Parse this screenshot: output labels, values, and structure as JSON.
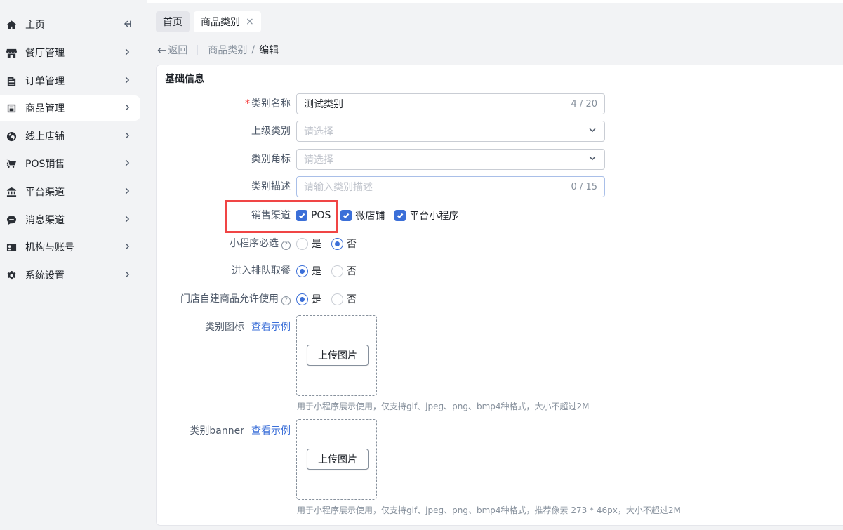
{
  "sidebar": {
    "items": [
      {
        "label": "主页",
        "icon": "home-icon"
      },
      {
        "label": "餐厅管理",
        "icon": "store-icon"
      },
      {
        "label": "订单管理",
        "icon": "order-icon"
      },
      {
        "label": "商品管理",
        "icon": "product-icon",
        "active": true
      },
      {
        "label": "线上店铺",
        "icon": "globe-icon"
      },
      {
        "label": "POS销售",
        "icon": "cart-icon"
      },
      {
        "label": "平台渠道",
        "icon": "bank-icon"
      },
      {
        "label": "消息渠道",
        "icon": "message-icon"
      },
      {
        "label": "机构与账号",
        "icon": "account-icon"
      },
      {
        "label": "系统设置",
        "icon": "gear-icon"
      }
    ]
  },
  "tabs": [
    {
      "label": "首页"
    },
    {
      "label": "商品类别",
      "close": "×"
    }
  ],
  "breadcrumb": {
    "back_arrow": "←",
    "back": "返回",
    "parent": "商品类别",
    "slash": "/",
    "current": "编辑"
  },
  "form": {
    "section_title": "基础信息",
    "name": {
      "required_mark": "*",
      "label": "类别名称",
      "value": "测试类别",
      "count": "4 / 20"
    },
    "parent": {
      "label": "上级类别",
      "placeholder": "请选择"
    },
    "corner": {
      "label": "类别角标",
      "placeholder": "请选择"
    },
    "desc": {
      "label": "类别描述",
      "placeholder": "请输入类别描述",
      "count": "0 / 15"
    },
    "channels": {
      "label": "销售渠道",
      "options": [
        {
          "label": "POS",
          "checked": true
        },
        {
          "label": "微店铺",
          "checked": true
        },
        {
          "label": "平台小程序",
          "checked": true
        }
      ]
    },
    "mini_required": {
      "label": "小程序必选",
      "help": "?",
      "yes": "是",
      "no": "否",
      "selected": "否"
    },
    "queue": {
      "label": "进入排队取餐",
      "yes": "是",
      "no": "否",
      "selected": "是"
    },
    "store_custom": {
      "label": "门店自建商品允许使用",
      "help": "?",
      "yes": "是",
      "no": "否",
      "selected": "是"
    },
    "icon": {
      "label": "类别图标",
      "example": "查看示例",
      "upload": "上传图片",
      "hint": "用于小程序展示使用，仅支持gif、jpeg、png、bmp4种格式，大小不超过2M"
    },
    "banner": {
      "label": "类别banner",
      "example": "查看示例",
      "upload": "上传图片",
      "hint": "用于小程序展示使用，仅支持gif、jpeg、png、bmp4种格式，推荐像素 273 * 46px，大小不超过2M"
    }
  },
  "colors": {
    "primary": "#3b6fd8",
    "highlight": "#f04545",
    "required": "#f53f3f"
  }
}
